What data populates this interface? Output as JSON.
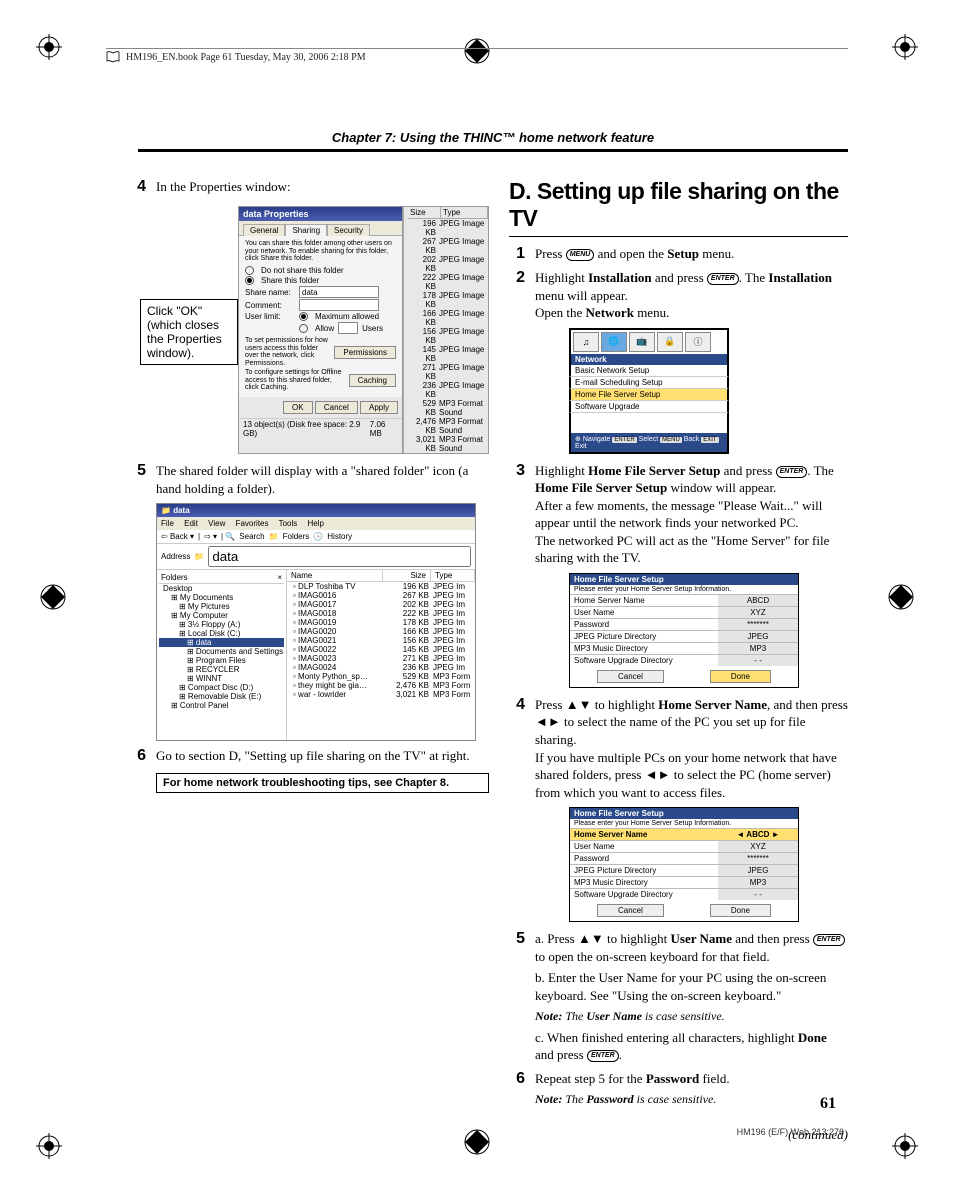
{
  "header": {
    "book_line": "HM196_EN.book  Page 61  Tuesday, May 30, 2006  2:18 PM"
  },
  "chapter": "Chapter 7: Using the THINC™ home network feature",
  "left": {
    "step4": "In the Properties window:",
    "callout": "Click \"OK\" (which closes the Properties window).",
    "step5": "The shared folder will display with a \"shared folder\" icon (a hand holding a folder).",
    "step6": "Go to section D, \"Setting up file sharing on the TV\" at right.",
    "tip": "For home network troubleshooting tips, see Chapter 8."
  },
  "props_dialog": {
    "title": "data Properties",
    "tabs": [
      "General",
      "Sharing",
      "Security"
    ],
    "intro": "You can share this folder among other users on your network. To enable sharing for this folder, click Share this folder.",
    "opt1": "Do not share this folder",
    "opt2": "Share this folder",
    "share_label": "Share name:",
    "share_val": "data",
    "comment_label": "Comment:",
    "userlimit_label": "User limit:",
    "ul_opt1": "Maximum allowed",
    "ul_opt2": "Allow",
    "ul_users": "Users",
    "perm_text": "To set permissions for how users access this folder over the network, click Permissions.",
    "perm_btn": "Permissions",
    "cache_text": "To configure settings for Offline access to this shared folder, click Caching.",
    "cache_btn": "Caching",
    "ok": "OK",
    "cancel": "Cancel",
    "apply": "Apply",
    "status": "13 object(s) (Disk free space: 2.9 GB)",
    "status_size": "7.06 MB"
  },
  "side_files": {
    "head": [
      "Size",
      "Type"
    ],
    "rows": [
      [
        "196 KB",
        "JPEG Image"
      ],
      [
        "267 KB",
        "JPEG Image"
      ],
      [
        "202 KB",
        "JPEG Image"
      ],
      [
        "222 KB",
        "JPEG Image"
      ],
      [
        "178 KB",
        "JPEG Image"
      ],
      [
        "166 KB",
        "JPEG Image"
      ],
      [
        "156 KB",
        "JPEG Image"
      ],
      [
        "145 KB",
        "JPEG Image"
      ],
      [
        "271 KB",
        "JPEG Image"
      ],
      [
        "236 KB",
        "JPEG Image"
      ],
      [
        "529 KB",
        "MP3 Format Sound"
      ],
      [
        "2,476 KB",
        "MP3 Format Sound"
      ],
      [
        "3,021 KB",
        "MP3 Format Sound"
      ]
    ]
  },
  "explorer": {
    "title": "data",
    "menus": [
      "File",
      "Edit",
      "View",
      "Favorites",
      "Tools",
      "Help"
    ],
    "tb_back": "Back",
    "tb_search": "Search",
    "tb_folders": "Folders",
    "tb_history": "History",
    "addr_label": "Address",
    "addr_val": "data",
    "folders_title": "Folders",
    "tree": [
      "Desktop",
      "  My Documents",
      "    My Pictures",
      "  My Computer",
      "    3½ Floppy (A:)",
      "    Local Disk (C:)",
      "      data",
      "      Documents and Settings",
      "      Program Files",
      "      RECYCLER",
      "      WINNT",
      "    Compact Disc (D:)",
      "    Removable Disk (E:)",
      "  Control Panel"
    ],
    "cols": [
      "Name",
      "Size",
      "Type"
    ],
    "files": [
      [
        "DLP Toshiba TV",
        "196 KB",
        "JPEG Im"
      ],
      [
        "IMAG0016",
        "267 KB",
        "JPEG Im"
      ],
      [
        "IMAG0017",
        "202 KB",
        "JPEG Im"
      ],
      [
        "IMAG0018",
        "222 KB",
        "JPEG Im"
      ],
      [
        "IMAG0019",
        "178 KB",
        "JPEG Im"
      ],
      [
        "IMAG0020",
        "166 KB",
        "JPEG Im"
      ],
      [
        "IMAG0021",
        "156 KB",
        "JPEG Im"
      ],
      [
        "IMAG0022",
        "145 KB",
        "JPEG Im"
      ],
      [
        "IMAG0023",
        "271 KB",
        "JPEG Im"
      ],
      [
        "IMAG0024",
        "236 KB",
        "JPEG Im"
      ],
      [
        "Monty Python_sp…",
        "529 KB",
        "MP3 Form"
      ],
      [
        "they might be gia…",
        "2,476 KB",
        "MP3 Form"
      ],
      [
        "war - lowrider",
        "3,021 KB",
        "MP3 Form"
      ]
    ]
  },
  "right": {
    "heading": "D. Setting up file sharing on the TV",
    "s1a": "Press ",
    "s1b": " and open the ",
    "s1c": "Setup",
    "s1d": " menu.",
    "s2a": "Highlight ",
    "s2b": "Installation",
    "s2c": " and press ",
    "s2d": ". The ",
    "s2e": "Installation",
    "s2f": " menu will appear.",
    "s2g": "Open the ",
    "s2h": "Network",
    "s2i": " menu.",
    "s3a": "Highlight ",
    "s3b": "Home File Server Setup",
    "s3c": " and press ",
    "s3d": ". The ",
    "s3e": "Home File Server Setup",
    "s3f": " window will appear.",
    "s3g": "After a few moments, the message \"Please Wait...\" will appear until the network finds your networked PC.",
    "s3h": "The networked PC will act as the \"Home Server\" for file sharing with the TV.",
    "s4a": "Press ",
    "s4b": " to highlight ",
    "s4c": "Home Server Name",
    "s4d": ", and then press ",
    "s4e": " to select the name of the PC you set up for file sharing.",
    "s4f": "If you have multiple PCs on your home network that have shared folders, press ",
    "s4g": " to select the PC (home server) from which you want to access files.",
    "s5aa": "a. Press ",
    "s5ab": " to highlight ",
    "s5ac": "User Name",
    "s5ad": " and then press ",
    "s5ae": " to open the on-screen keyboard for that field.",
    "s5b": "b. Enter the User Name for your PC using the on-screen keyboard. See \"Using the on-screen keyboard.\"",
    "s5note_a": "Note:",
    "s5note_b": " The ",
    "s5note_c": "User Name",
    "s5note_d": " is case sensitive.",
    "s5ca": "c. When finished entering all characters, highlight ",
    "s5cb": "Done",
    "s5cc": " and press ",
    "s5cd": ".",
    "s6a": "Repeat step 5 for the ",
    "s6b": "Password",
    "s6c": " field.",
    "s6note_a": "Note:",
    "s6note_b": " The ",
    "s6note_c": "Password",
    "s6note_d": " is case sensitive.",
    "continued": "(continued)"
  },
  "tvmenu": {
    "title": "Network",
    "items": [
      "Basic Network Setup",
      "E-mail Scheduling Setup",
      "Home File Server Setup",
      "Software Upgrade"
    ],
    "footer_nav": "Navigate",
    "footer_sel": "Select",
    "footer_back": "Back",
    "footer_exit": "Exit",
    "btn_enter": "ENTER",
    "btn_menu": "MENU",
    "btn_exit": "EXIT"
  },
  "setup1": {
    "title": "Home File Server Setup",
    "sub": "Please enter your Home Server Setup Information.",
    "rows": [
      [
        "Home Server Name",
        "ABCD"
      ],
      [
        "User Name",
        "XYZ"
      ],
      [
        "Password",
        "*******"
      ],
      [
        "JPEG Picture Directory",
        "JPEG"
      ],
      [
        "MP3 Music Directory",
        "MP3"
      ],
      [
        "Software Upgrade Directory",
        "- -"
      ]
    ],
    "cancel": "Cancel",
    "done": "Done"
  },
  "setup2": {
    "title": "Home File Server Setup",
    "sub": "Please enter your Home Server Setup Information.",
    "left_arrow": "◄",
    "right_arrow": "►",
    "rows": [
      [
        "Home Server Name",
        "ABCD"
      ],
      [
        "User Name",
        "XYZ"
      ],
      [
        "Password",
        "*******"
      ],
      [
        "JPEG Picture Directory",
        "JPEG"
      ],
      [
        "MP3 Music Directory",
        "MP3"
      ],
      [
        "Software Upgrade Directory",
        "- -"
      ]
    ],
    "cancel": "Cancel",
    "done": "Done"
  },
  "icons": {
    "menu": "MENU",
    "enter": "ENTER",
    "up_down": "▲▼",
    "left_right": "◄►"
  },
  "page_num": "61",
  "footer_code": "HM196 (E/F) Web 213:276"
}
